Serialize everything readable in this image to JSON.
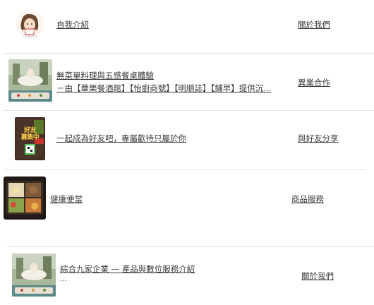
{
  "items": [
    {
      "title": "自我介紹",
      "action": "關於我們",
      "image": "avatar-illustration"
    },
    {
      "title": "無菜單料理與五感餐桌體驗",
      "subtitle": "－由【華樂餐酒館】【怡廚商號】【明順誌】【鋪早】提供沉...",
      "action": "異業合作",
      "image": "outdoor-dining-photo"
    },
    {
      "title": "一起成為好友吧，專屬歡待只屬於你",
      "action": "與好友分享",
      "image": "friend-recruit-poster",
      "poster_text": "好友募集中"
    },
    {
      "title": "健康便當",
      "action": "商品服務",
      "image": "bento-photo"
    },
    {
      "title": "綜合九家企業 — 產品與數位服務介紹",
      "subtitle": "...",
      "action": "關於我們",
      "image": "outdoor-dining-photo"
    }
  ]
}
